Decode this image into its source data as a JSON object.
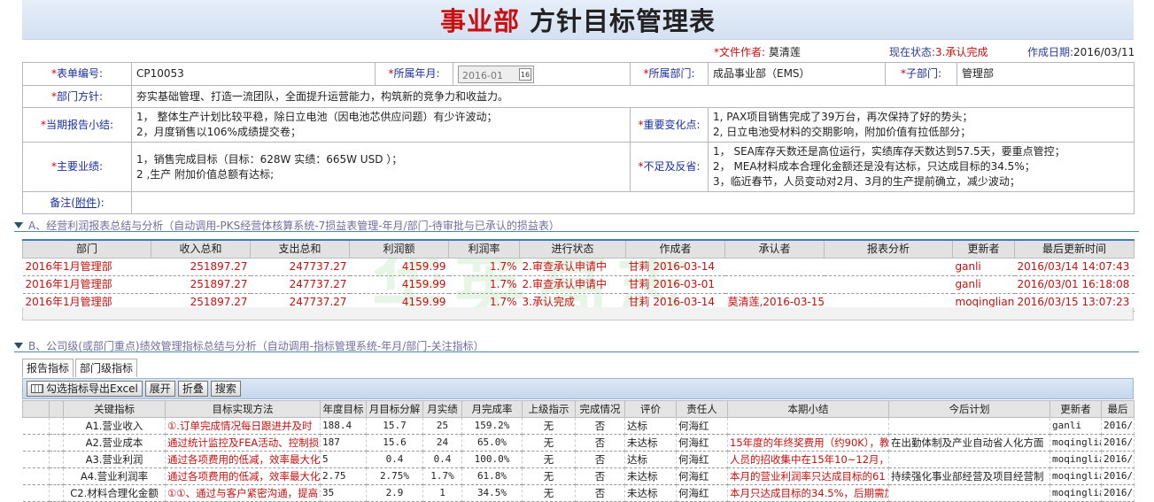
{
  "header": {
    "title_red": "事业部",
    "title_black": " 方针目标管理表"
  },
  "meta": {
    "author_label": "*文件作者:",
    "author": "莫清莲",
    "status_label": "现在状态:",
    "status": "3.承认完成",
    "date_label": "作成日期:",
    "date": "2016/03/11"
  },
  "form": {
    "form_no_label": "表单编号:",
    "form_no": "CP10053",
    "year_month_label": "所属年月:",
    "year_month": "2016-01",
    "cal_glyph": "16",
    "dept_label": "所属部门:",
    "dept": "成品事业部（EMS）",
    "subdept_label": "子部门:",
    "subdept": "管理部",
    "policy_label": "部门方针:",
    "policy": "夯实基础管理、打造一流团队，全面提升运营能力，构筑新的竞争力和收益力。",
    "summary_label": "当期报告小结:",
    "summary_1": "1，  整体生产计划比较平稳，除日立电池（因电池芯供应问题）有少许波动；",
    "summary_2": "  2，月度销售以106%成绩提交卷；",
    "changes_label": "重要变化点:",
    "changes_1": "1, PAX项目销售完成了39万台，再次保持了好的势头；",
    "changes_2": "  2, 日立电池受材料的交期影响，附加价值有拉低部分；",
    "perf_label": "主要业绩:",
    "perf_1": "1，销售完成目标（目标：628W  实绩：665W USD    ）；",
    "perf_2": "  2 ,生产 附加价值总额有达标;",
    "issues_label": "不足及反省:",
    "issues_1": "1，  SEA库存天数还是高位运行，实绩库存天数达到57.5天，要重点管控；",
    "issues_2": "  2，   MEA材料成本合理化金额还是没有达标，只达成目标的34.5%；",
    "issues_3": "  3，临近春节，人员变动对2月、3月的生产提前确立，减少波动；",
    "remark_label": "备注(",
    "remark_link": "附件",
    "remark_close": "):"
  },
  "section_a": {
    "title": "A、经营利润报表总结与分析（自动调用-PKS经营体核算系统-7损益表管理-年月/部门-待审批与已承认的损益表）"
  },
  "watermark": "华英高志",
  "grid1": {
    "columns": [
      "部门",
      "收入总和",
      "支出总和",
      "利润额",
      "利润率",
      "进行状态",
      "作成者",
      "承认者",
      "报表分析",
      "更新者",
      "最后更新时间"
    ],
    "rows": [
      [
        "2016年1月管理部",
        "251897.27",
        "247737.27",
        "4159.99",
        "1.7%",
        "2.审查承认申请中",
        "甘莉 2016-03-14",
        "",
        "",
        "ganli",
        "2016/03/14 14:07:43"
      ],
      [
        "2016年1月管理部",
        "251897.27",
        "247737.27",
        "4159.99",
        "1.7%",
        "2.审查承认申请中",
        "甘莉 2016-03-01",
        "",
        "",
        "ganli",
        "2016/03/01 16:18:08"
      ],
      [
        "2016年1月管理部",
        "251897.27",
        "247737.27",
        "4159.99",
        "1.7%",
        "3.承认完成",
        "甘莉 2016-03-14",
        "莫清莲,2016-03-15",
        "",
        "moqinglian",
        "2016/03/15 13:07:23"
      ]
    ]
  },
  "section_b": {
    "title": "B、公司级(或部门重点)绩效管理指标总结与分析（自动调用-指标管理系统-年月/部门-关注指标）"
  },
  "tabs": [
    "报告指标",
    "部门级指标"
  ],
  "toolbar": {
    "export": "勾选指标导出Excel",
    "expand": "展开",
    "collapse": "折叠",
    "search": "搜索"
  },
  "grid2": {
    "columns": [
      "",
      "",
      "关键指标",
      "目标实现方法",
      "年度目标",
      "月目标分解",
      "月实绩",
      "月完成率",
      "上级指示",
      "完成情况",
      "评价",
      "责任人",
      "本期小结",
      "今后计划",
      "更新者",
      "最后"
    ],
    "rows": [
      [
        "",
        "",
        "A1.营业收入",
        "①.订单完成情况每日跟进并及时",
        "188.4",
        "15.7",
        "25",
        "159.2%",
        "无",
        "否",
        "达标",
        "何海红",
        "",
        "",
        "ganli",
        "2016/"
      ],
      [
        "",
        "",
        "A2.营业成本",
        "通过统计监控及FEA活动、控制损",
        "187",
        "15.6",
        "24",
        "65.0%",
        "无",
        "否",
        "未达标",
        "何海红",
        "15年度的年终奖费用（约90K），教",
        "在出勤体制及产业自动省人化方面",
        "moqinglia",
        "2016/"
      ],
      [
        "",
        "",
        "A3.营业利润",
        "通过各项费用的低减，效率最大化",
        "5",
        "0.4",
        "0.4",
        "100.0%",
        "无",
        "否",
        "达标",
        "何海红",
        "人员的招收集中在15年10~12月，[",
        "",
        "moqinglia",
        "2016/"
      ],
      [
        "",
        "",
        "A4.营业利润率",
        "通过各项费用的低减，效率最大化",
        "2.75",
        "2.75%",
        "1.7%",
        "61.8%",
        "无",
        "否",
        "未达标",
        "何海红",
        "本月的营业利润率只达成目标的61",
        "持续强化事业部经营及项目经营制",
        "moqinglia",
        "2016/"
      ],
      [
        "",
        "",
        "C2.材料合理化金额",
        "①①、通过与客户紧密沟通，提高",
        "35",
        "2.9",
        "1",
        "34.5%",
        "无",
        "否",
        "未达标",
        "何海红",
        "本月只达成目标的34.5%，后期需加",
        "",
        "moqinglia",
        "2016/"
      ]
    ]
  }
}
